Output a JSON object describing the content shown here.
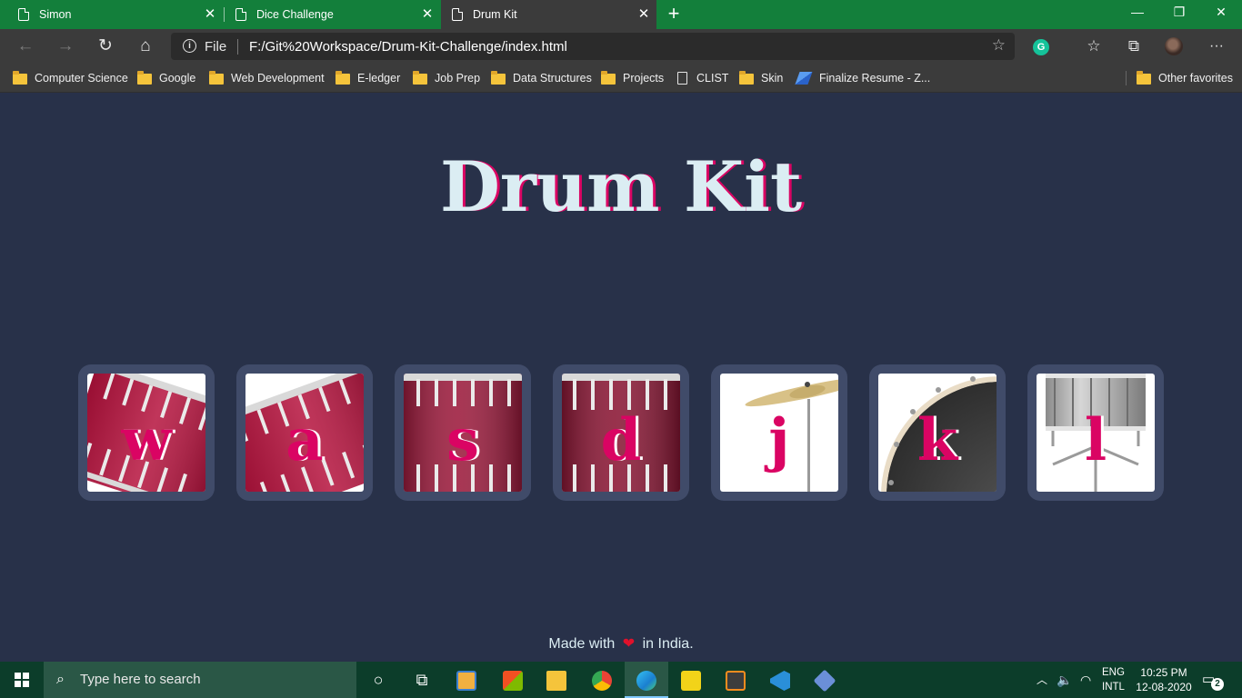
{
  "browser": {
    "tabs": [
      {
        "title": "Simon",
        "close": "✕"
      },
      {
        "title": "Dice Challenge",
        "close": "✕"
      },
      {
        "title": "Drum Kit",
        "close": "✕"
      }
    ],
    "new_tab": "+",
    "window_controls": {
      "minimize": "—",
      "restore": "❐",
      "close": "✕"
    },
    "nav": {
      "back": "←",
      "forward": "→",
      "refresh": "↻",
      "home": "⌂"
    },
    "address": {
      "info": "i",
      "scheme": "File",
      "url": "F:/Git%20Workspace/Drum-Kit-Challenge/index.html",
      "star": "☆"
    },
    "extensions": {
      "grammarly": "G",
      "favorites": "☆",
      "collections": "⧉",
      "menu": "···"
    },
    "bookmarks": [
      {
        "label": "Computer Science",
        "icon": "folder-icon"
      },
      {
        "label": "Google",
        "icon": "folder-icon"
      },
      {
        "label": "Web Development",
        "icon": "folder-icon"
      },
      {
        "label": "E-ledger",
        "icon": "folder-icon"
      },
      {
        "label": "Job Prep",
        "icon": "folder-icon"
      },
      {
        "label": "Data Structures",
        "icon": "folder-icon"
      },
      {
        "label": "Projects",
        "icon": "folder-icon"
      },
      {
        "label": "CLIST",
        "icon": "page-icon"
      },
      {
        "label": "Skin",
        "icon": "folder-icon"
      },
      {
        "label": "Finalize Resume - Z...",
        "icon": "app-icon"
      }
    ],
    "other_favorites": "Other favorites"
  },
  "page": {
    "title": "Drum Kit",
    "drums": [
      {
        "key": "w",
        "image": "tom1"
      },
      {
        "key": "a",
        "image": "tom2"
      },
      {
        "key": "s",
        "image": "tom3"
      },
      {
        "key": "d",
        "image": "tom4"
      },
      {
        "key": "j",
        "image": "crash"
      },
      {
        "key": "k",
        "image": "kick"
      },
      {
        "key": "l",
        "image": "snare"
      }
    ],
    "footer": {
      "before": "Made with",
      "heart": "❤",
      "after": "in India."
    }
  },
  "taskbar": {
    "search_placeholder": "Type here to search",
    "lang_top": "ENG",
    "lang_bottom": "INTL",
    "time": "10:25 PM",
    "date": "12-08-2020",
    "notifications": "2"
  },
  "colors": {
    "page_bg": "#283149",
    "drum_frame": "#404b69",
    "title_text": "#dbedf3",
    "accent": "#da0463",
    "tab_bar": "#137f3b",
    "taskbar": "#0c3d2a"
  }
}
